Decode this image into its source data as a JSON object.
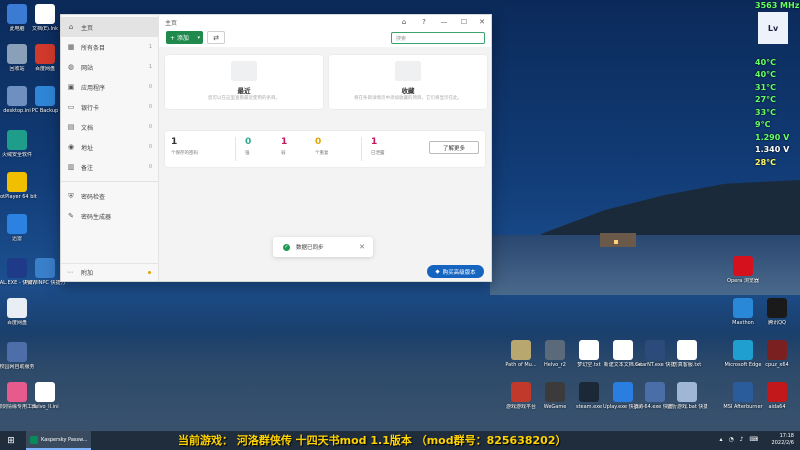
{
  "desktop": {
    "left_icons": [
      {
        "label": "此电脑",
        "color": "#3b7bd4"
      },
      {
        "label": "回收站",
        "color": "#8aa0b8"
      },
      {
        "label": "desktop.ini",
        "color": "#6e8fbf"
      },
      {
        "label": "火绒安全软件",
        "color": "#1e9e8a"
      },
      {
        "label": "PotPlayer 64 bit",
        "color": "#f0c000"
      },
      {
        "label": "迅雷",
        "color": "#2b82e0"
      },
      {
        "label": "PAL.EXE - 快捷方式",
        "color": "#203a8a"
      },
      {
        "label": "百度网盘",
        "color": "#e9eef5"
      },
      {
        "label": "校园网自助服务",
        "color": "#4d6ea8"
      },
      {
        "label": "御剑情缘专用工具",
        "color": "#e75a8c"
      }
    ],
    "left_col2_icons": [
      {
        "label": "文档(E).lnk",
        "color": "#ffffff"
      },
      {
        "label": "百度网盘",
        "color": "#d0392b"
      },
      {
        "label": "PC Backup",
        "color": "#2f86d6"
      },
      {
        "label": "PalWINPC 快捷方式",
        "color": "#3a7fc9"
      },
      {
        "label": "Helvo_II.ini",
        "color": "#ffffff"
      }
    ],
    "right_icons": [
      {
        "label": "Opera 浏览器",
        "color": "#d4111d"
      },
      {
        "label": "Maxthon",
        "color": "#2a88d8"
      },
      {
        "label": "腾讯QQ",
        "color": "#1a1a1a"
      },
      {
        "label": "Microsoft Edge",
        "color": "#1f9fd0"
      },
      {
        "label": "cpuz_x64",
        "color": "#7a2020"
      },
      {
        "label": "MSI Afterburner",
        "color": "#2a5c9c"
      },
      {
        "label": "aida64",
        "color": "#c2181b"
      }
    ],
    "bottom_icons": [
      {
        "label": "Path of Mu...",
        "color": "#b8a870"
      },
      {
        "label": "Helvo_r2",
        "color": "#5a6a7a"
      },
      {
        "label": "梦幻空.txt",
        "color": "#ffffff"
      },
      {
        "label": "新建文本文档.txt",
        "color": "#ffffff"
      },
      {
        "label": "GearNT.exe 快捷方式",
        "color": "#2c4a7a"
      },
      {
        "label": "仿真客服.txt",
        "color": "#ffffff"
      },
      {
        "label": "游戏游戏平台",
        "color": "#c0392b"
      },
      {
        "label": "WeGame",
        "color": "#3b3b3b"
      },
      {
        "label": "steam.exe",
        "color": "#1b2838"
      },
      {
        "label": "Uplay.exe 快捷方式",
        "color": "#2a7de1"
      },
      {
        "label": "pal-64.exe 快捷方式",
        "color": "#4a6ea8"
      },
      {
        "label": "运行游戏.bat 快捷方式",
        "color": "#9fb6d4"
      }
    ]
  },
  "window": {
    "title": "主页",
    "sidebar": {
      "items": [
        {
          "label": "主页",
          "icon": "home-icon",
          "glyph": "⌂",
          "count": ""
        },
        {
          "label": "所有条目",
          "icon": "grid-icon",
          "glyph": "▦",
          "count": "1"
        },
        {
          "label": "网站",
          "icon": "globe-icon",
          "glyph": "◍",
          "count": "1"
        },
        {
          "label": "应用程序",
          "icon": "app-icon",
          "glyph": "▣",
          "count": "0"
        },
        {
          "label": "银行卡",
          "icon": "card-icon",
          "glyph": "▭",
          "count": "0"
        },
        {
          "label": "文档",
          "icon": "document-icon",
          "glyph": "▤",
          "count": "0"
        },
        {
          "label": "地址",
          "icon": "location-icon",
          "glyph": "◉",
          "count": "0"
        },
        {
          "label": "备注",
          "icon": "note-icon",
          "glyph": "▥",
          "count": "0"
        }
      ],
      "tools": [
        {
          "label": "密码检查",
          "icon": "shield-check-icon",
          "glyph": "⛨"
        },
        {
          "label": "密码生成器",
          "icon": "wand-icon",
          "glyph": "✎"
        }
      ],
      "bottom": {
        "label": "附加",
        "glyph": "⋯"
      }
    },
    "toolbar": {
      "add_label": "+ 添加",
      "search_placeholder": "搜索"
    },
    "cards": {
      "recent": {
        "title": "最近",
        "desc": "您可以在这里查看最近使用的条目。"
      },
      "favorites": {
        "title": "收藏",
        "desc": "将在条目详情页中添加收藏的项目，它们将显示在此。"
      }
    },
    "stats": [
      {
        "num": "1",
        "label": "个保存的密码",
        "color": "#333333"
      },
      {
        "num": "0",
        "label": "强",
        "color": "#2aa98b"
      },
      {
        "num": "1",
        "label": "弱",
        "color": "#c2185b"
      },
      {
        "num": "0",
        "label": "个重复",
        "color": "#e0a400"
      },
      {
        "num": "1",
        "label": "已泄露",
        "color": "#c2185b"
      }
    ],
    "learn_more": "了解更多",
    "toast": "数据已同步",
    "upgrade": "购买高级版本"
  },
  "hw_monitor": {
    "logo": "Lv",
    "lines": [
      {
        "text": "3563 MHz",
        "color": "#66ff66"
      },
      {
        "text": "40°C",
        "color": "#66ff66"
      },
      {
        "text": "40°C",
        "color": "#66ff66"
      },
      {
        "text": "31°C",
        "color": "#66ff66"
      },
      {
        "text": "27°C",
        "color": "#66ff66"
      },
      {
        "text": "33°C",
        "color": "#66ff66"
      },
      {
        "text": "9°C",
        "color": "#66ff66"
      },
      {
        "text": "1.290 V",
        "color": "#66ff66"
      },
      {
        "text": "1.340 V",
        "color": "#ffffff"
      },
      {
        "text": "28°C",
        "color": "#ffff66"
      }
    ]
  },
  "taskbar": {
    "app_label": "Kaspersky Passw...",
    "overlay": "当前游戏： 河洛群侠传 十四天书mod 1.1版本 （mod群号：825638202）",
    "time": "17:18",
    "date": "2022/2/6"
  }
}
